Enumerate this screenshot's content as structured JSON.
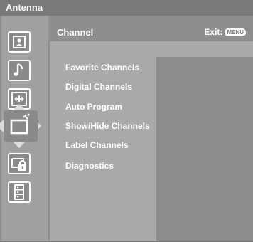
{
  "window": {
    "title": "Antenna"
  },
  "header": {
    "title": "Channel",
    "exit_label": "Exit:",
    "exit_button": "MENU"
  },
  "icons": [
    {
      "name": "picture-icon"
    },
    {
      "name": "music-note-icon"
    },
    {
      "name": "screen-adjust-icon"
    },
    {
      "name": "channel-tv-icon"
    },
    {
      "name": "parental-lock-icon"
    },
    {
      "name": "setup-list-icon"
    }
  ],
  "menu": {
    "items": [
      {
        "label": "Favorite Channels"
      },
      {
        "label": "Digital Channels"
      },
      {
        "label": "Auto Program"
      },
      {
        "label": "Show/Hide Channels"
      },
      {
        "label": "Label Channels"
      },
      {
        "label": "Diagnostics"
      }
    ]
  },
  "colors": {
    "background": "#8f8f8f",
    "text": "#ffffff",
    "highlight": "#dcdcdc"
  }
}
